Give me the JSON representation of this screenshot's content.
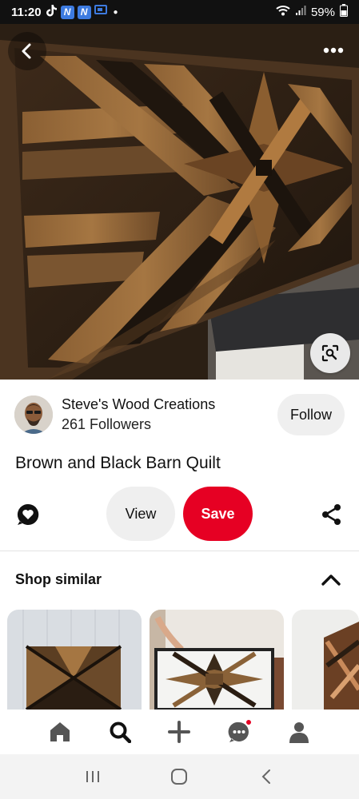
{
  "status_bar": {
    "time": "11:20",
    "notification_icons": [
      "tiktok-icon",
      "n-app-icon",
      "n-app-icon",
      "screen-icon"
    ],
    "badge_letters": [
      "N",
      "N"
    ],
    "battery": "59%"
  },
  "creator": {
    "name": "Steve's Wood Creations",
    "followers": "261 Followers",
    "follow_label": "Follow"
  },
  "pin": {
    "title": "Brown and Black Barn Quilt"
  },
  "actions": {
    "view_label": "View",
    "save_label": "Save"
  },
  "shop": {
    "title": "Shop similar"
  },
  "colors": {
    "accent": "#e60023",
    "button_gray": "#efefef",
    "text": "#111111"
  },
  "bottom_nav": [
    "home-icon",
    "search-icon",
    "create-icon",
    "messages-icon",
    "profile-icon"
  ],
  "system_nav": [
    "recents-icon",
    "home-circle-icon",
    "back-icon"
  ]
}
